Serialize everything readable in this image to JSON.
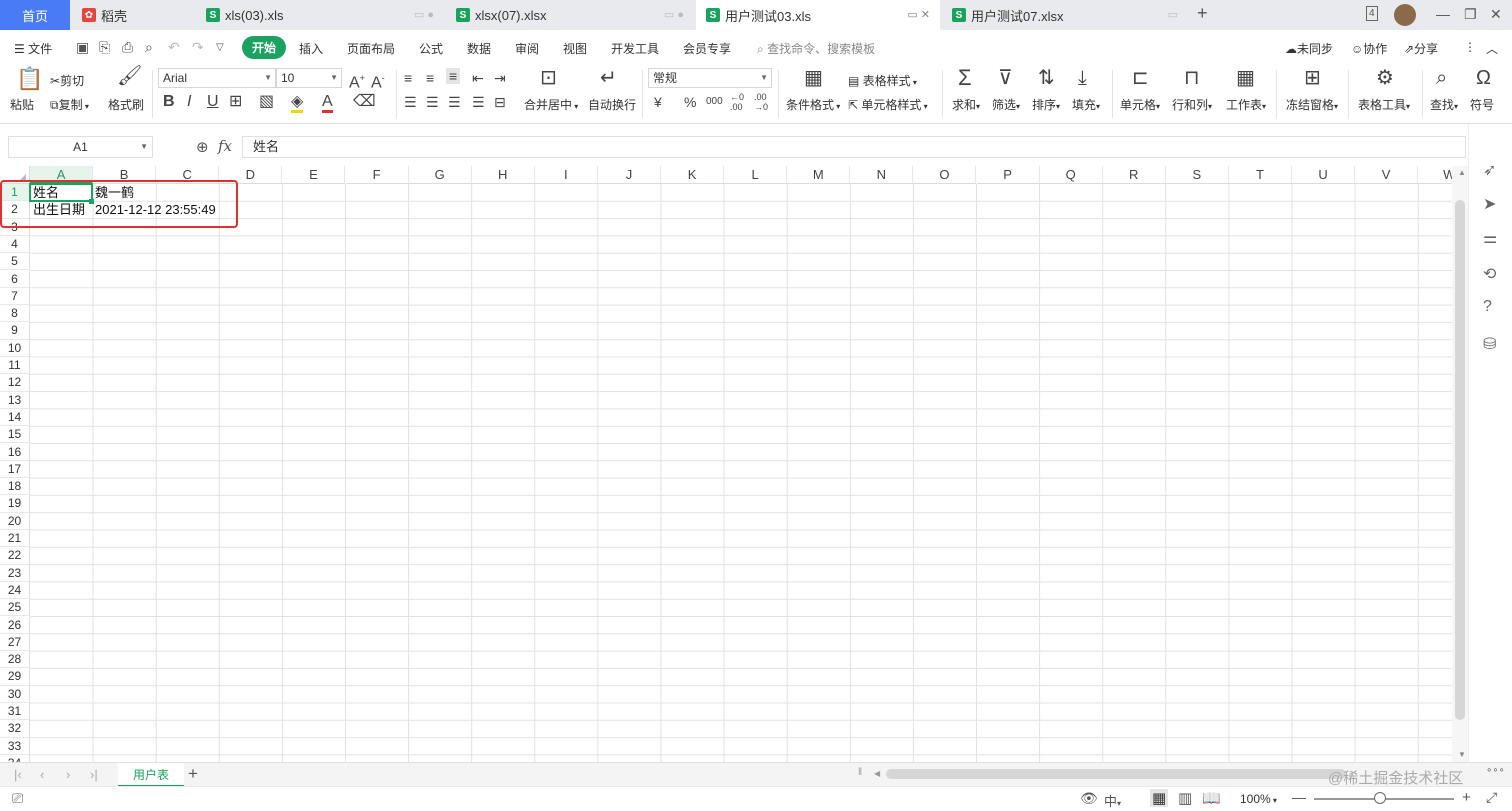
{
  "titlebar": {
    "tabs": [
      {
        "label": "首页",
        "type": "home"
      },
      {
        "label": "稻壳",
        "type": "docer"
      },
      {
        "label": "xls(03).xls",
        "type": "sheet"
      },
      {
        "label": "xlsx(07).xlsx",
        "type": "sheet"
      },
      {
        "label": "用户测试03.xls",
        "type": "sheet",
        "active": true
      },
      {
        "label": "用户测试07.xlsx",
        "type": "sheet"
      }
    ],
    "tab_count_badge": "4",
    "new_tab": "+",
    "sheet_icon_letter": "S"
  },
  "menubar": {
    "file": "文件",
    "items": [
      "开始",
      "插入",
      "页面布局",
      "公式",
      "数据",
      "审阅",
      "视图",
      "开发工具",
      "会员专享"
    ],
    "active": "开始",
    "search_placeholder": "查找命令、搜索模板",
    "sync": "未同步",
    "collab": "协作",
    "share": "分享"
  },
  "ribbon": {
    "paste": "粘贴",
    "cut": "剪切",
    "copy": "复制",
    "format_painter": "格式刷",
    "font_name": "Arial",
    "font_size": "10",
    "merge_center": "合并居中",
    "auto_wrap": "自动换行",
    "number_format": "常规",
    "cond_format": "条件格式",
    "table_style": "表格样式",
    "cell_style": "单元格样式",
    "sum": "求和",
    "filter": "筛选",
    "sort": "排序",
    "fill": "填充",
    "cells": "单元格",
    "row_col": "行和列",
    "worksheet": "工作表",
    "freeze": "冻结窗格",
    "table_tools": "表格工具",
    "find": "查找",
    "symbol": "符号",
    "bold": "B",
    "italic": "I",
    "underline": "U",
    "currency": "¥",
    "percent": "%",
    "thousands": "000",
    "inc_decimal": "←0 .00",
    "dec_decimal": ".00 →0"
  },
  "formulabar": {
    "cell_ref": "A1",
    "fx": "fx",
    "content": "姓名"
  },
  "grid": {
    "columns": [
      "A",
      "B",
      "C",
      "D",
      "E",
      "F",
      "G",
      "H",
      "I",
      "J",
      "K",
      "L",
      "M",
      "N",
      "O",
      "P",
      "Q",
      "R",
      "S",
      "T",
      "U",
      "V",
      "W"
    ],
    "row_count": 34,
    "selected_column": "A",
    "selected_row": 1,
    "cells": {
      "A1": "姓名",
      "B1": "魏一鹤",
      "A2": "出生日期",
      "B2": "2021-12-12 23:55:49"
    },
    "highlight_color": "#e03030",
    "accent_color": "#1aa260"
  },
  "sheetbar": {
    "sheets": [
      "用户表"
    ],
    "add": "+"
  },
  "statusbar": {
    "zoom": "100%",
    "input_mode": "中",
    "watermark": "@稀土掘金技术社区"
  }
}
